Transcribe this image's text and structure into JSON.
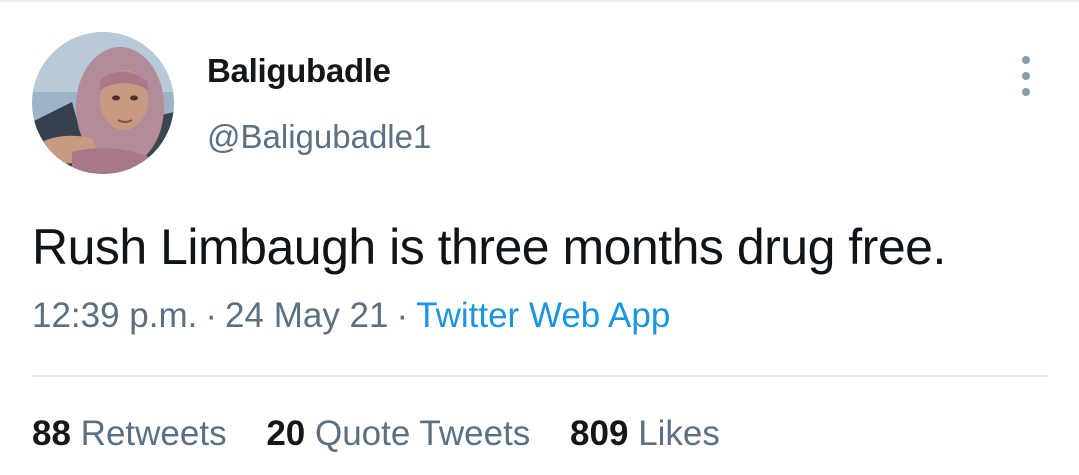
{
  "tweet": {
    "author": {
      "display_name": "Baligubadle",
      "handle": "@Baligubadle1"
    },
    "text": "Rush Limbaugh is three months drug free.",
    "time": "12:39 p.m.",
    "date": "24 May 21",
    "source": "Twitter Web App",
    "separator": "·"
  },
  "stats": {
    "retweets_count": "88",
    "retweets_label": "Retweets",
    "quotes_count": "20",
    "quotes_label": "Quote Tweets",
    "likes_count": "809",
    "likes_label": "Likes"
  },
  "icons": {
    "more": "more-vertical-icon"
  },
  "colors": {
    "text_primary": "#0f1419",
    "text_secondary": "#5b7083",
    "link": "#1b95e0",
    "divider": "#e6ecf0"
  }
}
